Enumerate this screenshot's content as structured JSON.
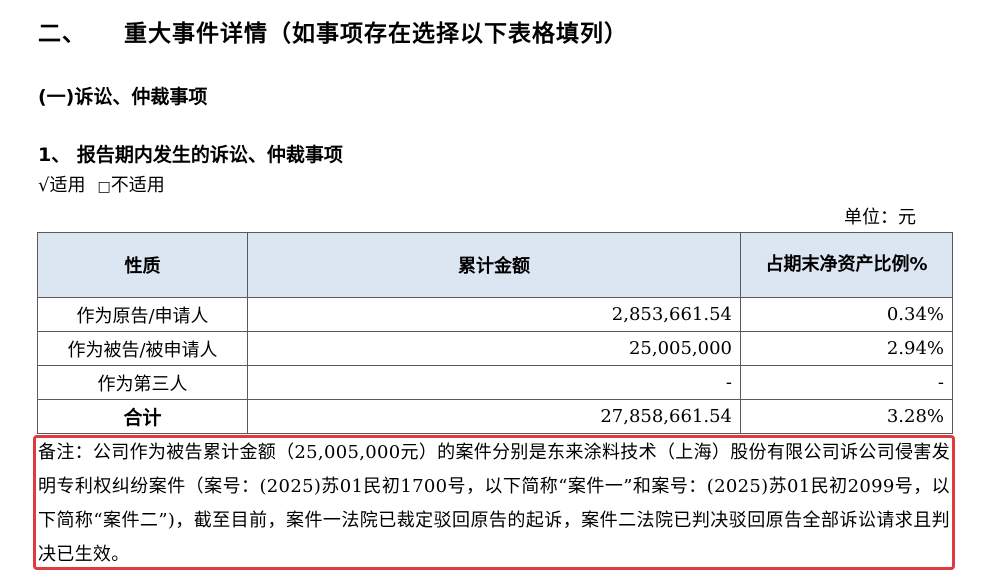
{
  "section": {
    "number": "二、",
    "title": "重大事件详情（如事项存在选择以下表格填列）"
  },
  "subsection": "(一)诉讼、仲裁事项",
  "item": "1、 报告期内发生的诉讼、仲裁事项",
  "applicability": {
    "applicable": "√适用",
    "not_applicable_box": "□",
    "not_applicable": "不适用"
  },
  "unit": "单位：元",
  "table": {
    "headers": [
      "性质",
      "累计金额",
      "占期末净资产比例%"
    ],
    "rows": [
      {
        "category": "作为原告/申请人",
        "amount": "2,853,661.54",
        "ratio": "0.34%"
      },
      {
        "category": "作为被告/被申请人",
        "amount": "25,005,000",
        "ratio": "2.94%"
      },
      {
        "category": "作为第三人",
        "amount": "-",
        "ratio": "-"
      },
      {
        "category": "合计",
        "amount": "27,858,661.54",
        "ratio": "3.28%"
      }
    ]
  },
  "note": "备注：公司作为被告累计金额（25,005,000元）的案件分别是东来涂料技术（上海）股份有限公司诉公司侵害发明专利权纠纷案件（案号：(2025)苏01民初1700号，以下简称“案件一”和案号：(2025)苏01民初2099号，以下简称“案件二”)，截至目前，案件一法院已裁定驳回原告的起诉，案件二法院已判决驳回原告全部诉讼请求且判决已生效。",
  "colors": {
    "header_bg": "#dce6f2",
    "highlight_border": "#e0393e"
  }
}
